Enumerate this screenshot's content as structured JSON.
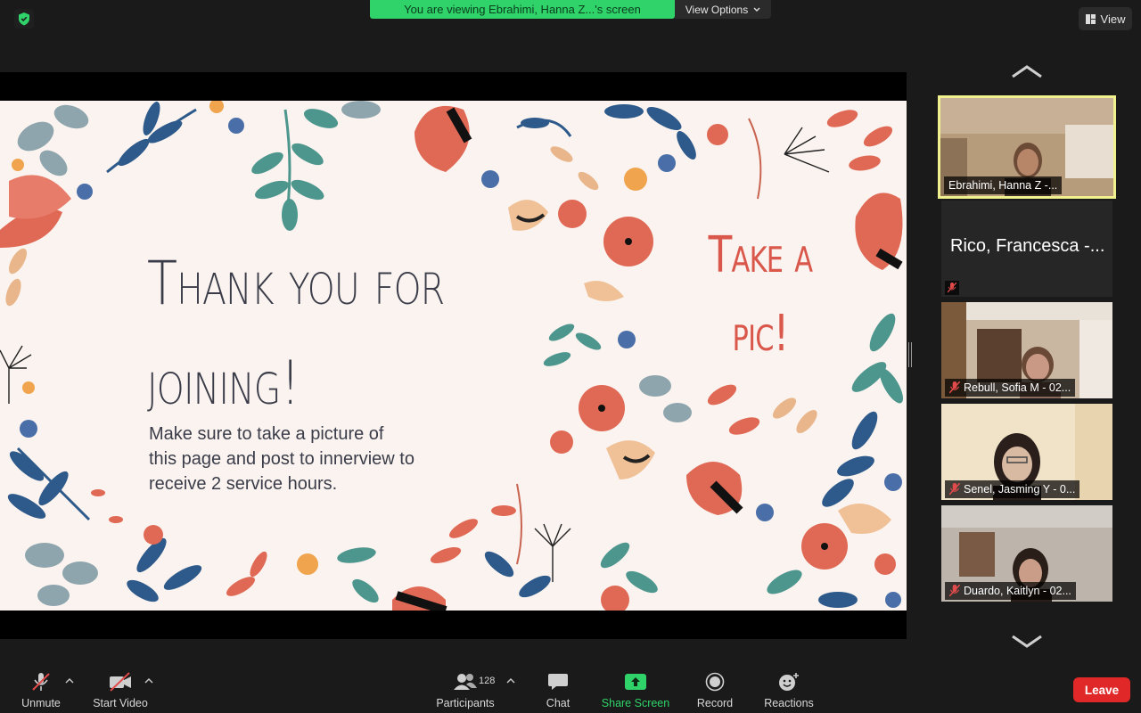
{
  "banner": {
    "viewing_text": "You are viewing Ebrahimi, Hanna Z...'s screen",
    "view_options_label": "View Options"
  },
  "view_button": {
    "label": "View"
  },
  "slide": {
    "title_line1": "Thank you for",
    "title_line2": "joining!",
    "body": "Make sure to take a picture of this page and post to innerview to receive 2 service hours.",
    "side_line1": "Take a",
    "side_line2": "pic!"
  },
  "participants": [
    {
      "name": "Ebrahimi, Hanna Z -...",
      "video": true,
      "active": true,
      "muted": false
    },
    {
      "name": "Rico, Francesca -...",
      "video": false,
      "active": false,
      "muted": true
    },
    {
      "name": "Rebull, Sofia M - 02...",
      "video": true,
      "active": false,
      "muted": true
    },
    {
      "name": "Senel, Jasming Y - 0...",
      "video": true,
      "active": false,
      "muted": true
    },
    {
      "name": "Duardo, Kaitlyn - 02...",
      "video": true,
      "active": false,
      "muted": true
    }
  ],
  "toolbar": {
    "unmute": "Unmute",
    "start_video": "Start Video",
    "participants": "Participants",
    "participant_count": "128",
    "chat": "Chat",
    "share_screen": "Share Screen",
    "record": "Record",
    "reactions": "Reactions",
    "leave": "Leave"
  },
  "colors": {
    "share_green": "#2fd36a",
    "leave_red": "#e02828",
    "active_speaker": "#f0f08e",
    "slide_title": "#3a3d49",
    "slide_accent": "#d9584b"
  }
}
